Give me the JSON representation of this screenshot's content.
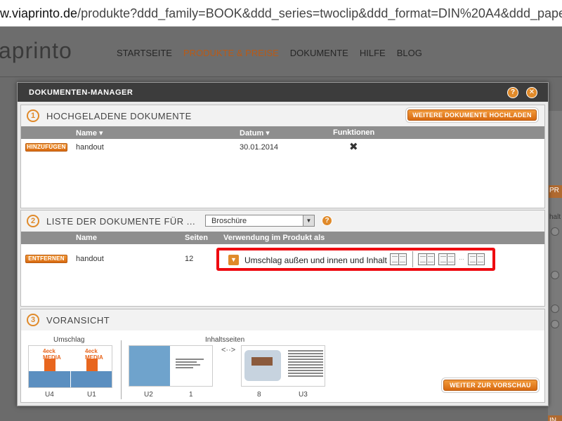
{
  "browser": {
    "url_host": "w.viaprinto.de",
    "url_path": "/produkte?ddd_family=BOOK&ddd_series=twoclip&ddd_format=DIN%20A4&ddd_paper=matt_weis"
  },
  "site": {
    "logo": "aprinto",
    "nav": [
      "STARTSEITE",
      "PRODUKTE & PREISE",
      "DOKUMENTE",
      "HILFE",
      "BLOG"
    ],
    "right_partial": [
      "PR",
      "halt",
      "IN"
    ]
  },
  "modal": {
    "title": "DOKUMENTEN-MANAGER",
    "help_icon": "question-icon",
    "close_icon": "close-icon",
    "section1": {
      "number": "1",
      "title": "HOCHGELADENE DOKUMENTE",
      "upload_button": "WEITERE DOKUMENTE HOCHLADEN",
      "columns": {
        "name": "Name",
        "datum": "Datum",
        "funktionen": "Funktionen"
      },
      "rows": [
        {
          "action": "HINZUFÜGEN",
          "name": "handout",
          "date": "30.01.2014"
        }
      ]
    },
    "section2": {
      "number": "2",
      "title": "LISTE DER DOKUMENTE FÜR ...",
      "select_value": "Broschüre",
      "columns": {
        "name": "Name",
        "seiten": "Seiten",
        "verwendung": "Verwendung im Produkt als"
      },
      "rows": [
        {
          "action": "ENTFERNEN",
          "name": "handout",
          "pages": "12",
          "usage": "Umschlag außen und innen und Inhalt"
        }
      ]
    },
    "section3": {
      "number": "3",
      "title": "VORANSICHT",
      "cover_label": "Umschlag",
      "content_label": "Inhaltsseiten",
      "page_labels": [
        "U4",
        "U1",
        "U2",
        "1",
        "8",
        "U3"
      ],
      "between_arrow": "<··>",
      "brand_text": "4eck MEDIA",
      "next_button": "WEITER ZUR VORSCHAU"
    }
  },
  "colors": {
    "accent": "#e08a2a",
    "highlight": "#ee0a10",
    "title_bar": "#3c3c3c"
  }
}
